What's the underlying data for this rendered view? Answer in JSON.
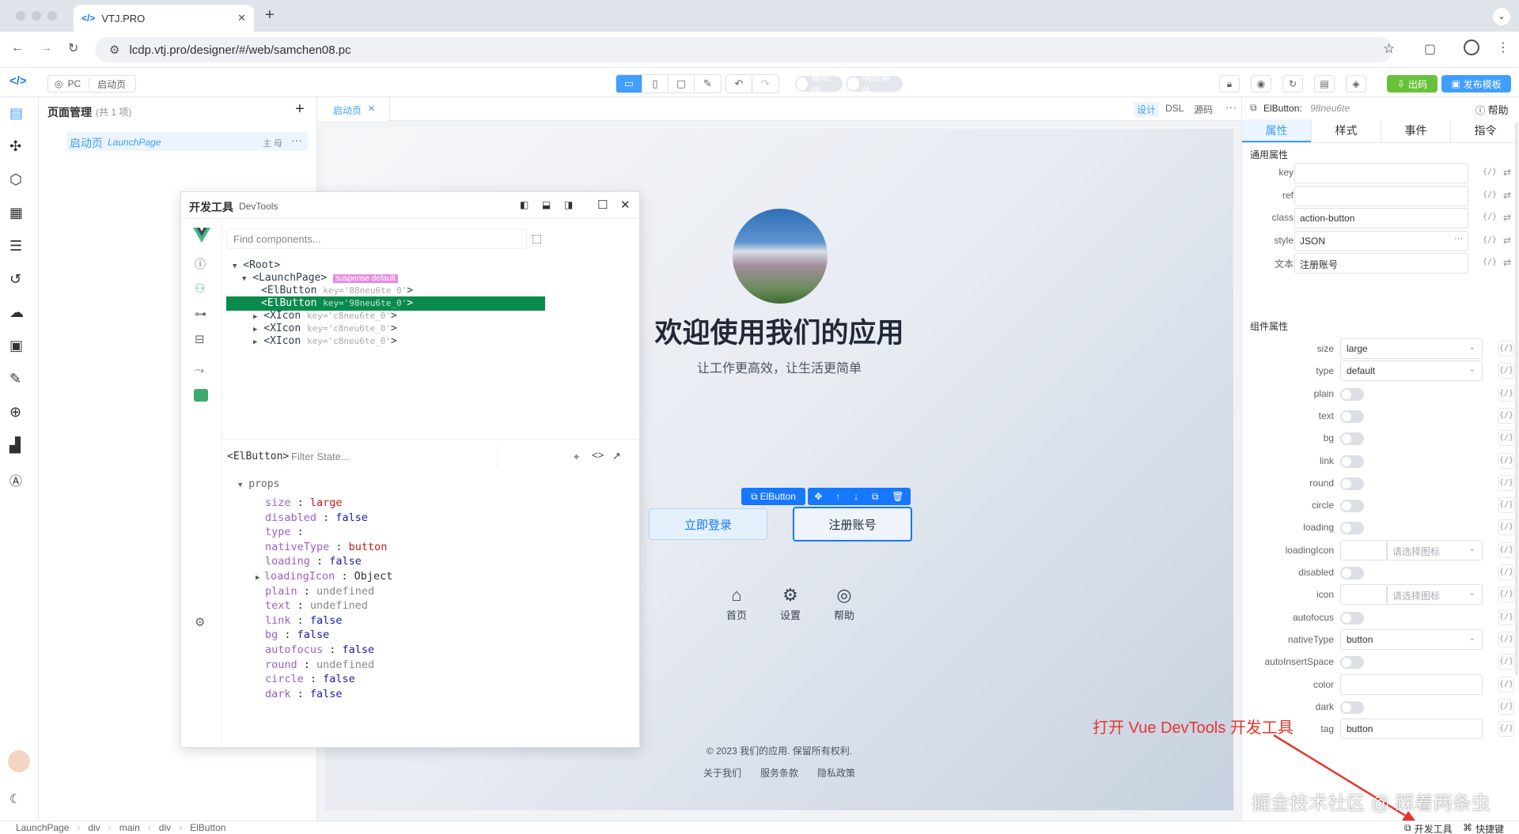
{
  "browser": {
    "tab_title": "VTJ.PRO",
    "url": "lcdp.vtj.pro/designer/#/web/samchen08.pc"
  },
  "toolbar": {
    "platform": "PC",
    "page": "启动页",
    "helper_line": "辅助线",
    "resp_event": "响应事件",
    "export_btn": "出码",
    "publish_btn": "发布模板"
  },
  "pages_panel": {
    "title": "页面管理",
    "count": "(共 1 项)",
    "item_name": "启动页",
    "item_sub": "LaunchPage",
    "item_tag": "主 母"
  },
  "center": {
    "tab": "启动页",
    "mode_design": "设计",
    "mode_dsl": "DSL",
    "mode_source": "源码"
  },
  "preview": {
    "welcome": "欢迎使用我们的应用",
    "subtitle": "让工作更高效，让生活更简单",
    "login_btn": "立即登录",
    "register_btn": "注册账号",
    "el_tag": "ElButton",
    "nav": [
      "首页",
      "设置",
      "帮助"
    ],
    "copyright": "© 2023 我们的应用. 保留所有权利.",
    "links": [
      "关于我们",
      "服务条款",
      "隐私政策"
    ]
  },
  "devtools": {
    "title": "开发工具",
    "subtitle": "DevTools",
    "search_placeholder": "Find components...",
    "tree": [
      {
        "name": "Root",
        "key": "",
        "badge": ""
      },
      {
        "name": "LaunchPage",
        "key": "",
        "badge": "suspense default"
      },
      {
        "name": "ElButton",
        "key": "key='88neu6te_0'",
        "badge": ""
      },
      {
        "name": "ElButton",
        "key": "key='98neu6te_0'",
        "badge": ""
      },
      {
        "name": "XIcon",
        "key": "key='c8neu6te_0'",
        "badge": ""
      },
      {
        "name": "XIcon",
        "key": "key='c8neu6te_0'",
        "badge": ""
      },
      {
        "name": "XIcon",
        "key": "key='c8neu6te_0'",
        "badge": ""
      }
    ],
    "selected": "ElButton",
    "filter_placeholder": "Filter State...",
    "props_label": "props",
    "props": [
      {
        "k": "size",
        "v": "large",
        "t": "str"
      },
      {
        "k": "disabled",
        "v": "false",
        "t": "bool"
      },
      {
        "k": "type",
        "v": "",
        "t": "str"
      },
      {
        "k": "nativeType",
        "v": "button",
        "t": "str"
      },
      {
        "k": "loading",
        "v": "false",
        "t": "bool"
      },
      {
        "k": "loadingIcon",
        "v": "Object",
        "t": "obj"
      },
      {
        "k": "plain",
        "v": "undefined",
        "t": "undef"
      },
      {
        "k": "text",
        "v": "undefined",
        "t": "undef"
      },
      {
        "k": "link",
        "v": "false",
        "t": "bool"
      },
      {
        "k": "bg",
        "v": "false",
        "t": "bool"
      },
      {
        "k": "autofocus",
        "v": "false",
        "t": "bool"
      },
      {
        "k": "round",
        "v": "undefined",
        "t": "undef"
      },
      {
        "k": "circle",
        "v": "false",
        "t": "bool"
      },
      {
        "k": "dark",
        "v": "false",
        "t": "bool"
      }
    ]
  },
  "right": {
    "component": "ElButton:",
    "component_id": "98neu6te",
    "help": "帮助",
    "tabs": [
      "属性",
      "样式",
      "事件",
      "指令"
    ],
    "general_title": "通用属性",
    "general": [
      {
        "label": "key",
        "value": ""
      },
      {
        "label": "ref",
        "value": ""
      },
      {
        "label": "class",
        "value": "action-button"
      },
      {
        "label": "style",
        "value": "JSON"
      },
      {
        "label": "文本",
        "value": "注册账号"
      }
    ],
    "comp_title": "组件属性",
    "comp": [
      {
        "label": "size",
        "kind": "select",
        "value": "large"
      },
      {
        "label": "type",
        "kind": "select",
        "value": "default"
      },
      {
        "label": "plain",
        "kind": "switch"
      },
      {
        "label": "text",
        "kind": "switch"
      },
      {
        "label": "bg",
        "kind": "switch"
      },
      {
        "label": "link",
        "kind": "switch"
      },
      {
        "label": "round",
        "kind": "switch"
      },
      {
        "label": "circle",
        "kind": "switch"
      },
      {
        "label": "loading",
        "kind": "switch"
      },
      {
        "label": "loadingIcon",
        "kind": "icon",
        "value": "请选择图标"
      },
      {
        "label": "disabled",
        "kind": "switch"
      },
      {
        "label": "icon",
        "kind": "icon",
        "value": "请选择图标"
      },
      {
        "label": "autofocus",
        "kind": "switch"
      },
      {
        "label": "nativeType",
        "kind": "select",
        "value": "button"
      },
      {
        "label": "autoInsertSpace",
        "kind": "switch"
      },
      {
        "label": "color",
        "kind": "input",
        "value": ""
      },
      {
        "label": "dark",
        "kind": "switch"
      },
      {
        "label": "tag",
        "kind": "input",
        "value": "button"
      }
    ]
  },
  "annotation": "打开 Vue DevTools 开发工具",
  "watermark": "掘金技术社区 @ 踩着两条虫",
  "status": {
    "breadcrumb": [
      "LaunchPage",
      "div",
      "main",
      "div",
      "ElButton"
    ],
    "devtools": "开发工具",
    "shortcuts": "快捷键"
  },
  "colors": {
    "primary": "#409eff",
    "success": "#67c23a",
    "vue_green": "#42b883",
    "selected_row": "#0a8a4c",
    "badge": "#e48ee0",
    "annotation": "#e8342e"
  }
}
